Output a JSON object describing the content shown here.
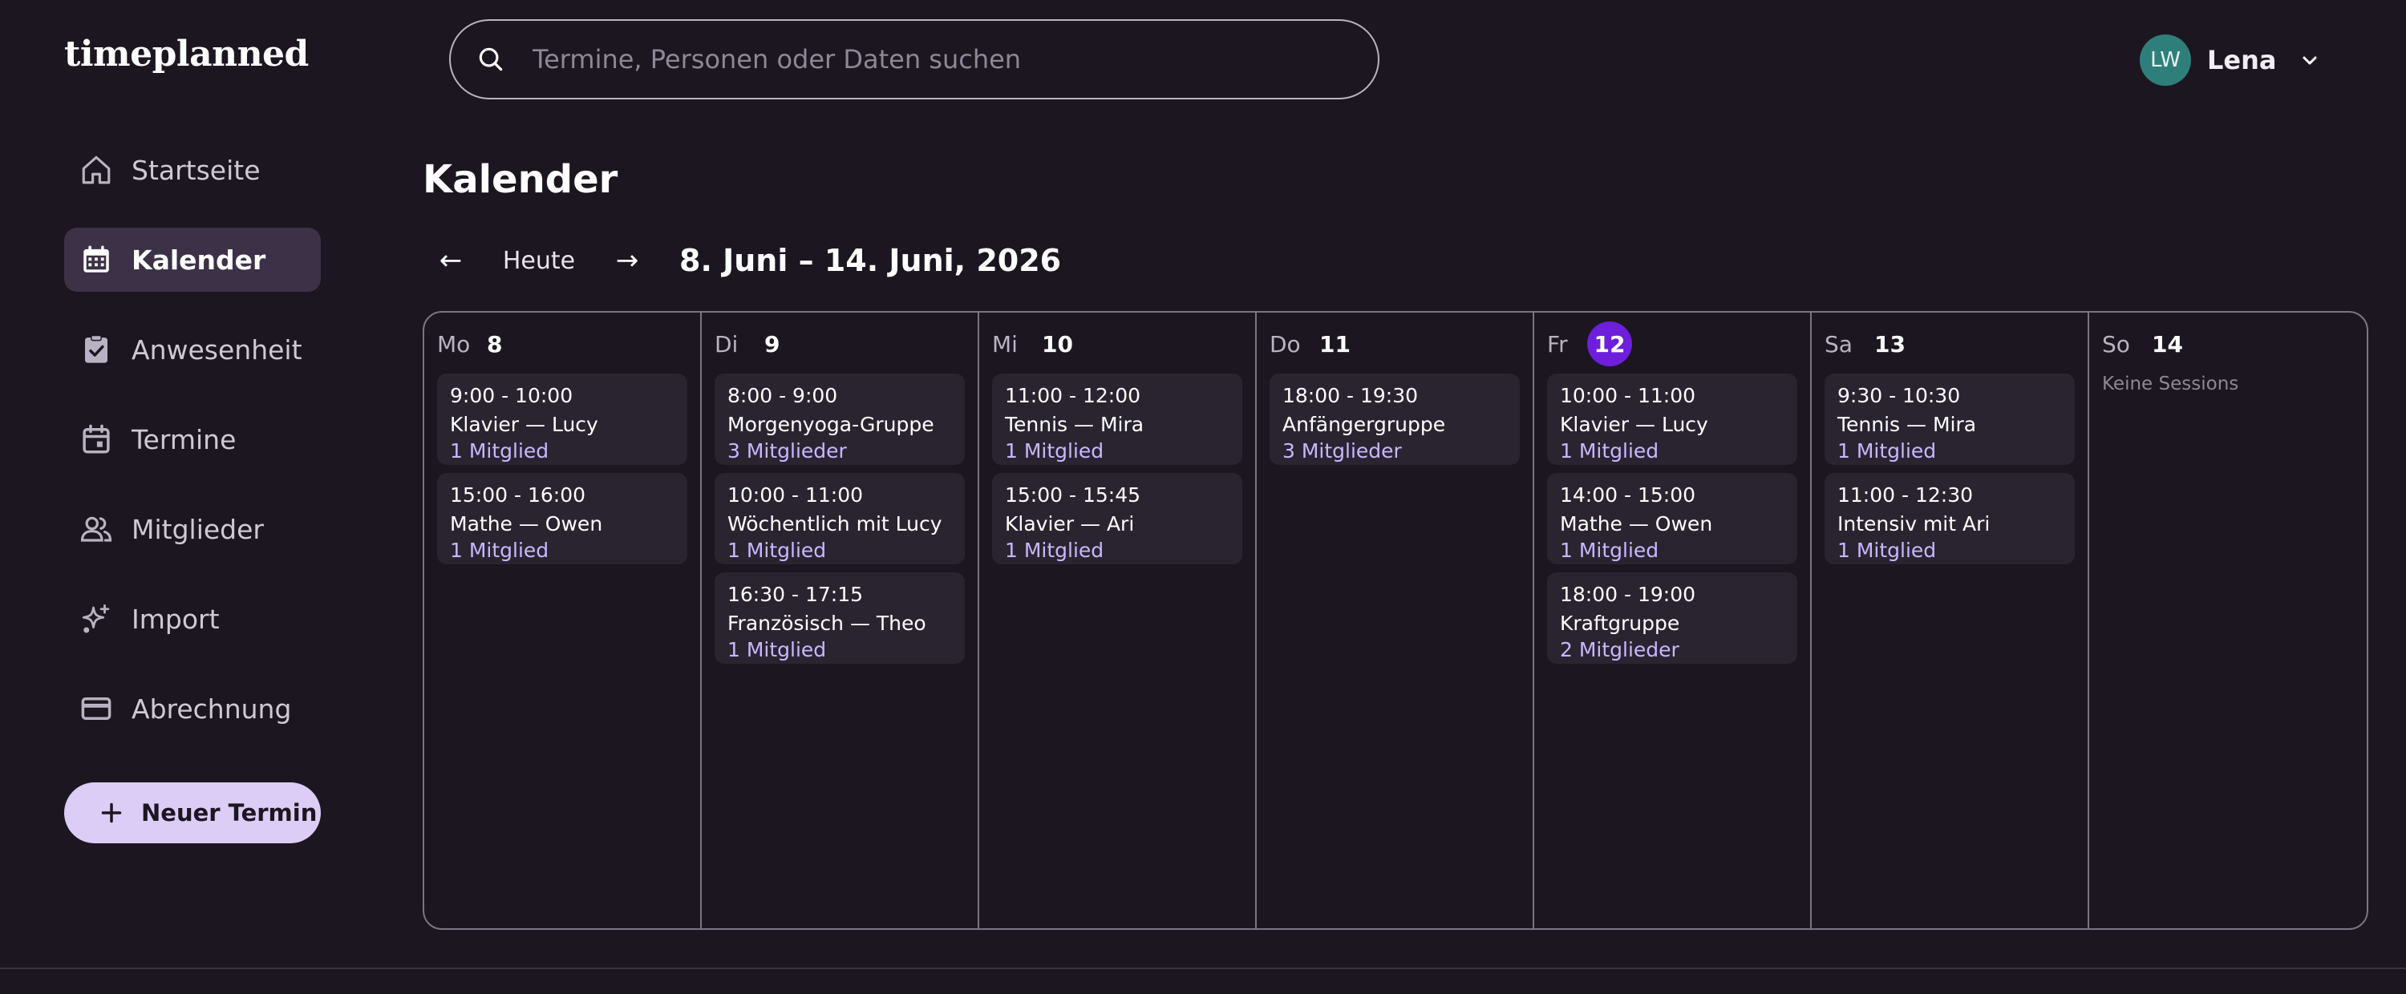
{
  "app": {
    "logo": "timeplanned"
  },
  "search": {
    "placeholder": "Termine, Personen oder Daten suchen",
    "value": ""
  },
  "user": {
    "initials": "LW",
    "name": "Lena"
  },
  "sidebar": {
    "items": [
      {
        "label": "Startseite",
        "icon": "home-icon",
        "active": false
      },
      {
        "label": "Kalender",
        "icon": "calendar-icon",
        "active": true
      },
      {
        "label": "Anwesenheit",
        "icon": "clipboard-check-icon",
        "active": false
      },
      {
        "label": "Termine",
        "icon": "event-icon",
        "active": false
      },
      {
        "label": "Mitglieder",
        "icon": "members-icon",
        "active": false
      },
      {
        "label": "Import",
        "icon": "sparkle-icon",
        "active": false
      },
      {
        "label": "Abrechnung",
        "icon": "credit-card-icon",
        "active": false
      }
    ],
    "new_button": "Neuer Termin"
  },
  "main": {
    "title": "Kalender",
    "toolbar": {
      "prev": "←",
      "today": "Heute",
      "next": "→",
      "range": "8. Juni – 14. Juni, 2026"
    }
  },
  "calendar": {
    "days": [
      {
        "dow": "Mo",
        "num": "8",
        "today": false,
        "events": [
          {
            "time": "9:00 - 10:00",
            "title": "Klavier — Lucy",
            "members": "1 Mitglied"
          },
          {
            "time": "15:00 - 16:00",
            "title": "Mathe — Owen",
            "members": "1 Mitglied"
          }
        ]
      },
      {
        "dow": "Di",
        "num": "9",
        "today": false,
        "events": [
          {
            "time": "8:00 - 9:00",
            "title": "Morgenyoga-Gruppe",
            "members": "3 Mitglieder"
          },
          {
            "time": "10:00 - 11:00",
            "title": "Wöchentlich mit Lucy",
            "members": "1 Mitglied"
          },
          {
            "time": "16:30 - 17:15",
            "title": "Französisch — Theo",
            "members": "1 Mitglied"
          }
        ]
      },
      {
        "dow": "Mi",
        "num": "10",
        "today": false,
        "events": [
          {
            "time": "11:00 - 12:00",
            "title": "Tennis — Mira",
            "members": "1 Mitglied"
          },
          {
            "time": "15:00 - 15:45",
            "title": "Klavier — Ari",
            "members": "1 Mitglied"
          }
        ]
      },
      {
        "dow": "Do",
        "num": "11",
        "today": false,
        "events": [
          {
            "time": "18:00 - 19:30",
            "title": "Anfängergruppe",
            "members": "3 Mitglieder"
          }
        ]
      },
      {
        "dow": "Fr",
        "num": "12",
        "today": true,
        "events": [
          {
            "time": "10:00 - 11:00",
            "title": "Klavier — Lucy",
            "members": "1 Mitglied"
          },
          {
            "time": "14:00 - 15:00",
            "title": "Mathe — Owen",
            "members": "1 Mitglied"
          },
          {
            "time": "18:00 - 19:00",
            "title": "Kraftgruppe",
            "members": "2 Mitglieder"
          }
        ]
      },
      {
        "dow": "Sa",
        "num": "13",
        "today": false,
        "events": [
          {
            "time": "9:30 - 10:30",
            "title": "Tennis — Mira",
            "members": "1 Mitglied"
          },
          {
            "time": "11:00 - 12:30",
            "title": "Intensiv mit Ari",
            "members": "1 Mitglied"
          }
        ]
      },
      {
        "dow": "So",
        "num": "14",
        "today": false,
        "empty_text": "Keine Sessions",
        "events": []
      }
    ]
  },
  "colors": {
    "background": "#1b1620",
    "accent": "#6d1fdc",
    "button": "#dccdf7",
    "members_text": "#c9b7ff",
    "avatar": "#2e7f7a"
  }
}
